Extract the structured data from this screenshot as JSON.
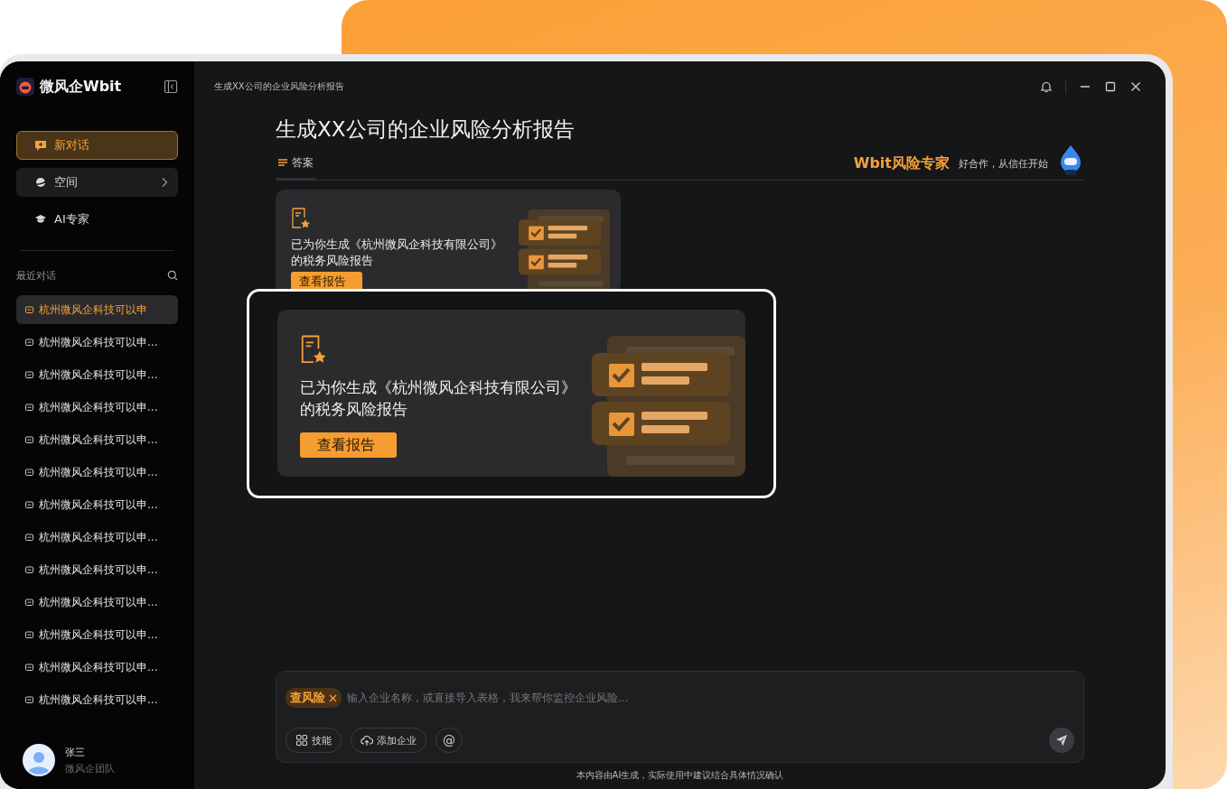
{
  "app": {
    "name": "微风企Wbit"
  },
  "sidebar": {
    "actions": [
      {
        "kind": "new",
        "label": "新对话",
        "selected": true
      },
      {
        "kind": "space",
        "label": "空间",
        "selected": false
      },
      {
        "kind": "expert",
        "label": "AI专家",
        "selected": false
      }
    ],
    "recent": {
      "title": "最近对话",
      "items": [
        {
          "label": "杭州微风企科技可以申",
          "selected": true
        },
        {
          "label": "杭州微风企科技可以申...",
          "selected": false
        },
        {
          "label": "杭州微风企科技可以申...",
          "selected": false
        },
        {
          "label": "杭州微风企科技可以申...",
          "selected": false
        },
        {
          "label": "杭州微风企科技可以申...",
          "selected": false
        },
        {
          "label": "杭州微风企科技可以申...",
          "selected": false
        },
        {
          "label": "杭州微风企科技可以申...",
          "selected": false
        },
        {
          "label": "杭州微风企科技可以申...",
          "selected": false
        },
        {
          "label": "杭州微风企科技可以申...",
          "selected": false
        },
        {
          "label": "杭州微风企科技可以申...",
          "selected": false
        },
        {
          "label": "杭州微风企科技可以申...",
          "selected": false
        },
        {
          "label": "杭州微风企科技可以申...",
          "selected": false
        },
        {
          "label": "杭州微风企科技可以申...",
          "selected": false
        }
      ]
    },
    "user": {
      "name": "张三",
      "team": "微风企团队"
    }
  },
  "topbar": {
    "title": "生成XX公司的企业风险分析报告"
  },
  "heading": "生成XX公司的企业风险分析报告",
  "tabs": [
    {
      "label": "答案",
      "selected": true
    }
  ],
  "expert": {
    "name": "Wbit风险专家",
    "slogan": "好合作，从信任开始"
  },
  "report_card": {
    "message": "已为你生成《杭州微风企科技有限公司》的税务风险报告",
    "button": "查看报告"
  },
  "callout_card": {
    "message": "已为你生成《杭州微风企科技有限公司》的税务风险报告",
    "button": "查看报告"
  },
  "composer": {
    "tag": "查风险",
    "placeholder": "输入企业名称，或直接导入表格，我来帮你监控企业风险...",
    "tools": [
      {
        "kind": "skills",
        "label": "技能"
      },
      {
        "kind": "add",
        "label": "添加企业"
      },
      {
        "kind": "mention",
        "label": "@"
      }
    ]
  },
  "disclaimer": "本内容由AI生成，实际使用中建议结合具体情况确认"
}
